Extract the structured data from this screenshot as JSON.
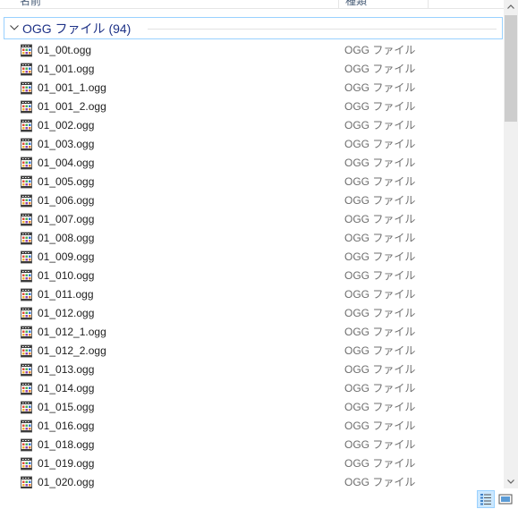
{
  "columns": {
    "name": "名前",
    "type": "種類"
  },
  "group": {
    "title": "OGG ファイル (94)"
  },
  "files": [
    {
      "name": "01_00t.ogg",
      "type": "OGG ファイル"
    },
    {
      "name": "01_001.ogg",
      "type": "OGG ファイル"
    },
    {
      "name": "01_001_1.ogg",
      "type": "OGG ファイル"
    },
    {
      "name": "01_001_2.ogg",
      "type": "OGG ファイル"
    },
    {
      "name": "01_002.ogg",
      "type": "OGG ファイル"
    },
    {
      "name": "01_003.ogg",
      "type": "OGG ファイル"
    },
    {
      "name": "01_004.ogg",
      "type": "OGG ファイル"
    },
    {
      "name": "01_005.ogg",
      "type": "OGG ファイル"
    },
    {
      "name": "01_006.ogg",
      "type": "OGG ファイル"
    },
    {
      "name": "01_007.ogg",
      "type": "OGG ファイル"
    },
    {
      "name": "01_008.ogg",
      "type": "OGG ファイル"
    },
    {
      "name": "01_009.ogg",
      "type": "OGG ファイル"
    },
    {
      "name": "01_010.ogg",
      "type": "OGG ファイル"
    },
    {
      "name": "01_011.ogg",
      "type": "OGG ファイル"
    },
    {
      "name": "01_012.ogg",
      "type": "OGG ファイル"
    },
    {
      "name": "01_012_1.ogg",
      "type": "OGG ファイル"
    },
    {
      "name": "01_012_2.ogg",
      "type": "OGG ファイル"
    },
    {
      "name": "01_013.ogg",
      "type": "OGG ファイル"
    },
    {
      "name": "01_014.ogg",
      "type": "OGG ファイル"
    },
    {
      "name": "01_015.ogg",
      "type": "OGG ファイル"
    },
    {
      "name": "01_016.ogg",
      "type": "OGG ファイル"
    },
    {
      "name": "01_018.ogg",
      "type": "OGG ファイル"
    },
    {
      "name": "01_019.ogg",
      "type": "OGG ファイル"
    },
    {
      "name": "01_020.ogg",
      "type": "OGG ファイル"
    }
  ],
  "icons": {
    "chevron": "chevron-down-icon",
    "file": "media-file-icon",
    "details_view": "details-view-icon",
    "tiles_view": "large-icons-view-icon"
  },
  "colors": {
    "group_title": "#1e3287",
    "group_border": "#99d1ff",
    "type_text": "#6d6d6d",
    "selected_view_bg": "#cce8ff"
  }
}
